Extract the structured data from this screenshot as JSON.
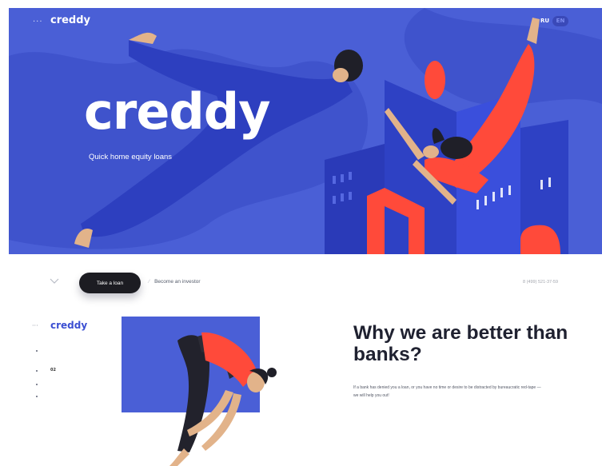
{
  "header": {
    "menu_icon": "dots-icon",
    "logo_text": "creddy",
    "lang_ru": "RU",
    "lang_en": "EN"
  },
  "hero": {
    "title": "creddy",
    "subtitle": "Quick home equity loans"
  },
  "actions": {
    "take_loan": "Take a loan",
    "become_investor": "Become an investor",
    "separator": "⁄",
    "phone": "8 (499) 521-37-59",
    "scroll_icon": "chevron-down-icon"
  },
  "section2": {
    "logo_text": "creddy",
    "nav_number": "02",
    "title": "Why we are better than banks?",
    "body": "If a bank has denied you a loan, or you have no time or desire to be distracted by bureaucratic red-tape — we will help you out!"
  },
  "colors": {
    "hero_blue": "#4a5fd6",
    "accent_red": "#ff4a3a",
    "dark_button": "#1c1c22",
    "brand_blue": "#3b4fd2"
  }
}
